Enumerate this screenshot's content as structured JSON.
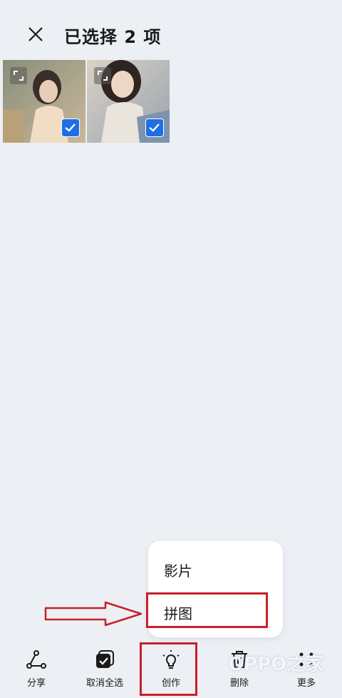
{
  "header": {
    "title": "已选择 2 项",
    "close_icon": "close-icon"
  },
  "thumbnails": [
    {
      "selected": true,
      "expand_icon": "expand-icon",
      "check_icon": "checkmark-icon"
    },
    {
      "selected": true,
      "expand_icon": "expand-icon",
      "check_icon": "checkmark-icon"
    }
  ],
  "popup_menu": {
    "items": [
      {
        "label": "影片"
      },
      {
        "label": "拼图"
      }
    ],
    "highlighted_item": "拼图"
  },
  "bottom_bar": {
    "items": [
      {
        "label": "分享",
        "icon": "share-icon"
      },
      {
        "label": "取消全选",
        "icon": "deselect-all-icon"
      },
      {
        "label": "创作",
        "icon": "lightbulb-icon"
      },
      {
        "label": "删除",
        "icon": "trash-icon"
      },
      {
        "label": "更多",
        "icon": "more-icon"
      }
    ]
  },
  "watermark": "OPPO之家",
  "colors": {
    "background": "#eceff3",
    "accent": "#1e6fe6",
    "annotation_red": "#c8202a"
  }
}
